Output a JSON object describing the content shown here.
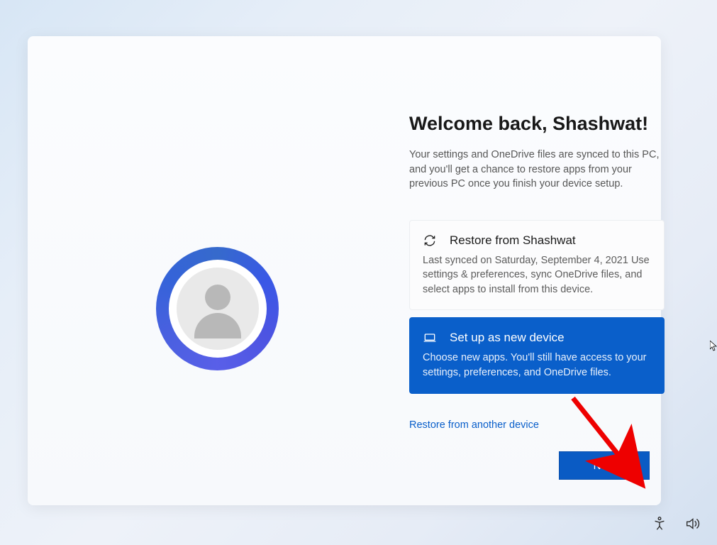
{
  "title": "Welcome back, Shashwat!",
  "subtitle": "Your settings and OneDrive files are synced to this PC, and you'll get a chance to restore apps from your previous PC once you finish your device setup.",
  "options": {
    "restore": {
      "title": "Restore from Shashwat",
      "desc": "Last synced on Saturday, September 4, 2021\nUse settings & preferences, sync OneDrive files, and select apps to install from this device.",
      "selected": false
    },
    "new": {
      "title": "Set up as new device",
      "desc": "Choose new apps. You'll still have access to your settings, preferences, and OneDrive files.",
      "selected": true
    }
  },
  "restore_link": "Restore from another device",
  "next_label": "Next",
  "colors": {
    "accent": "#0a5fca"
  }
}
